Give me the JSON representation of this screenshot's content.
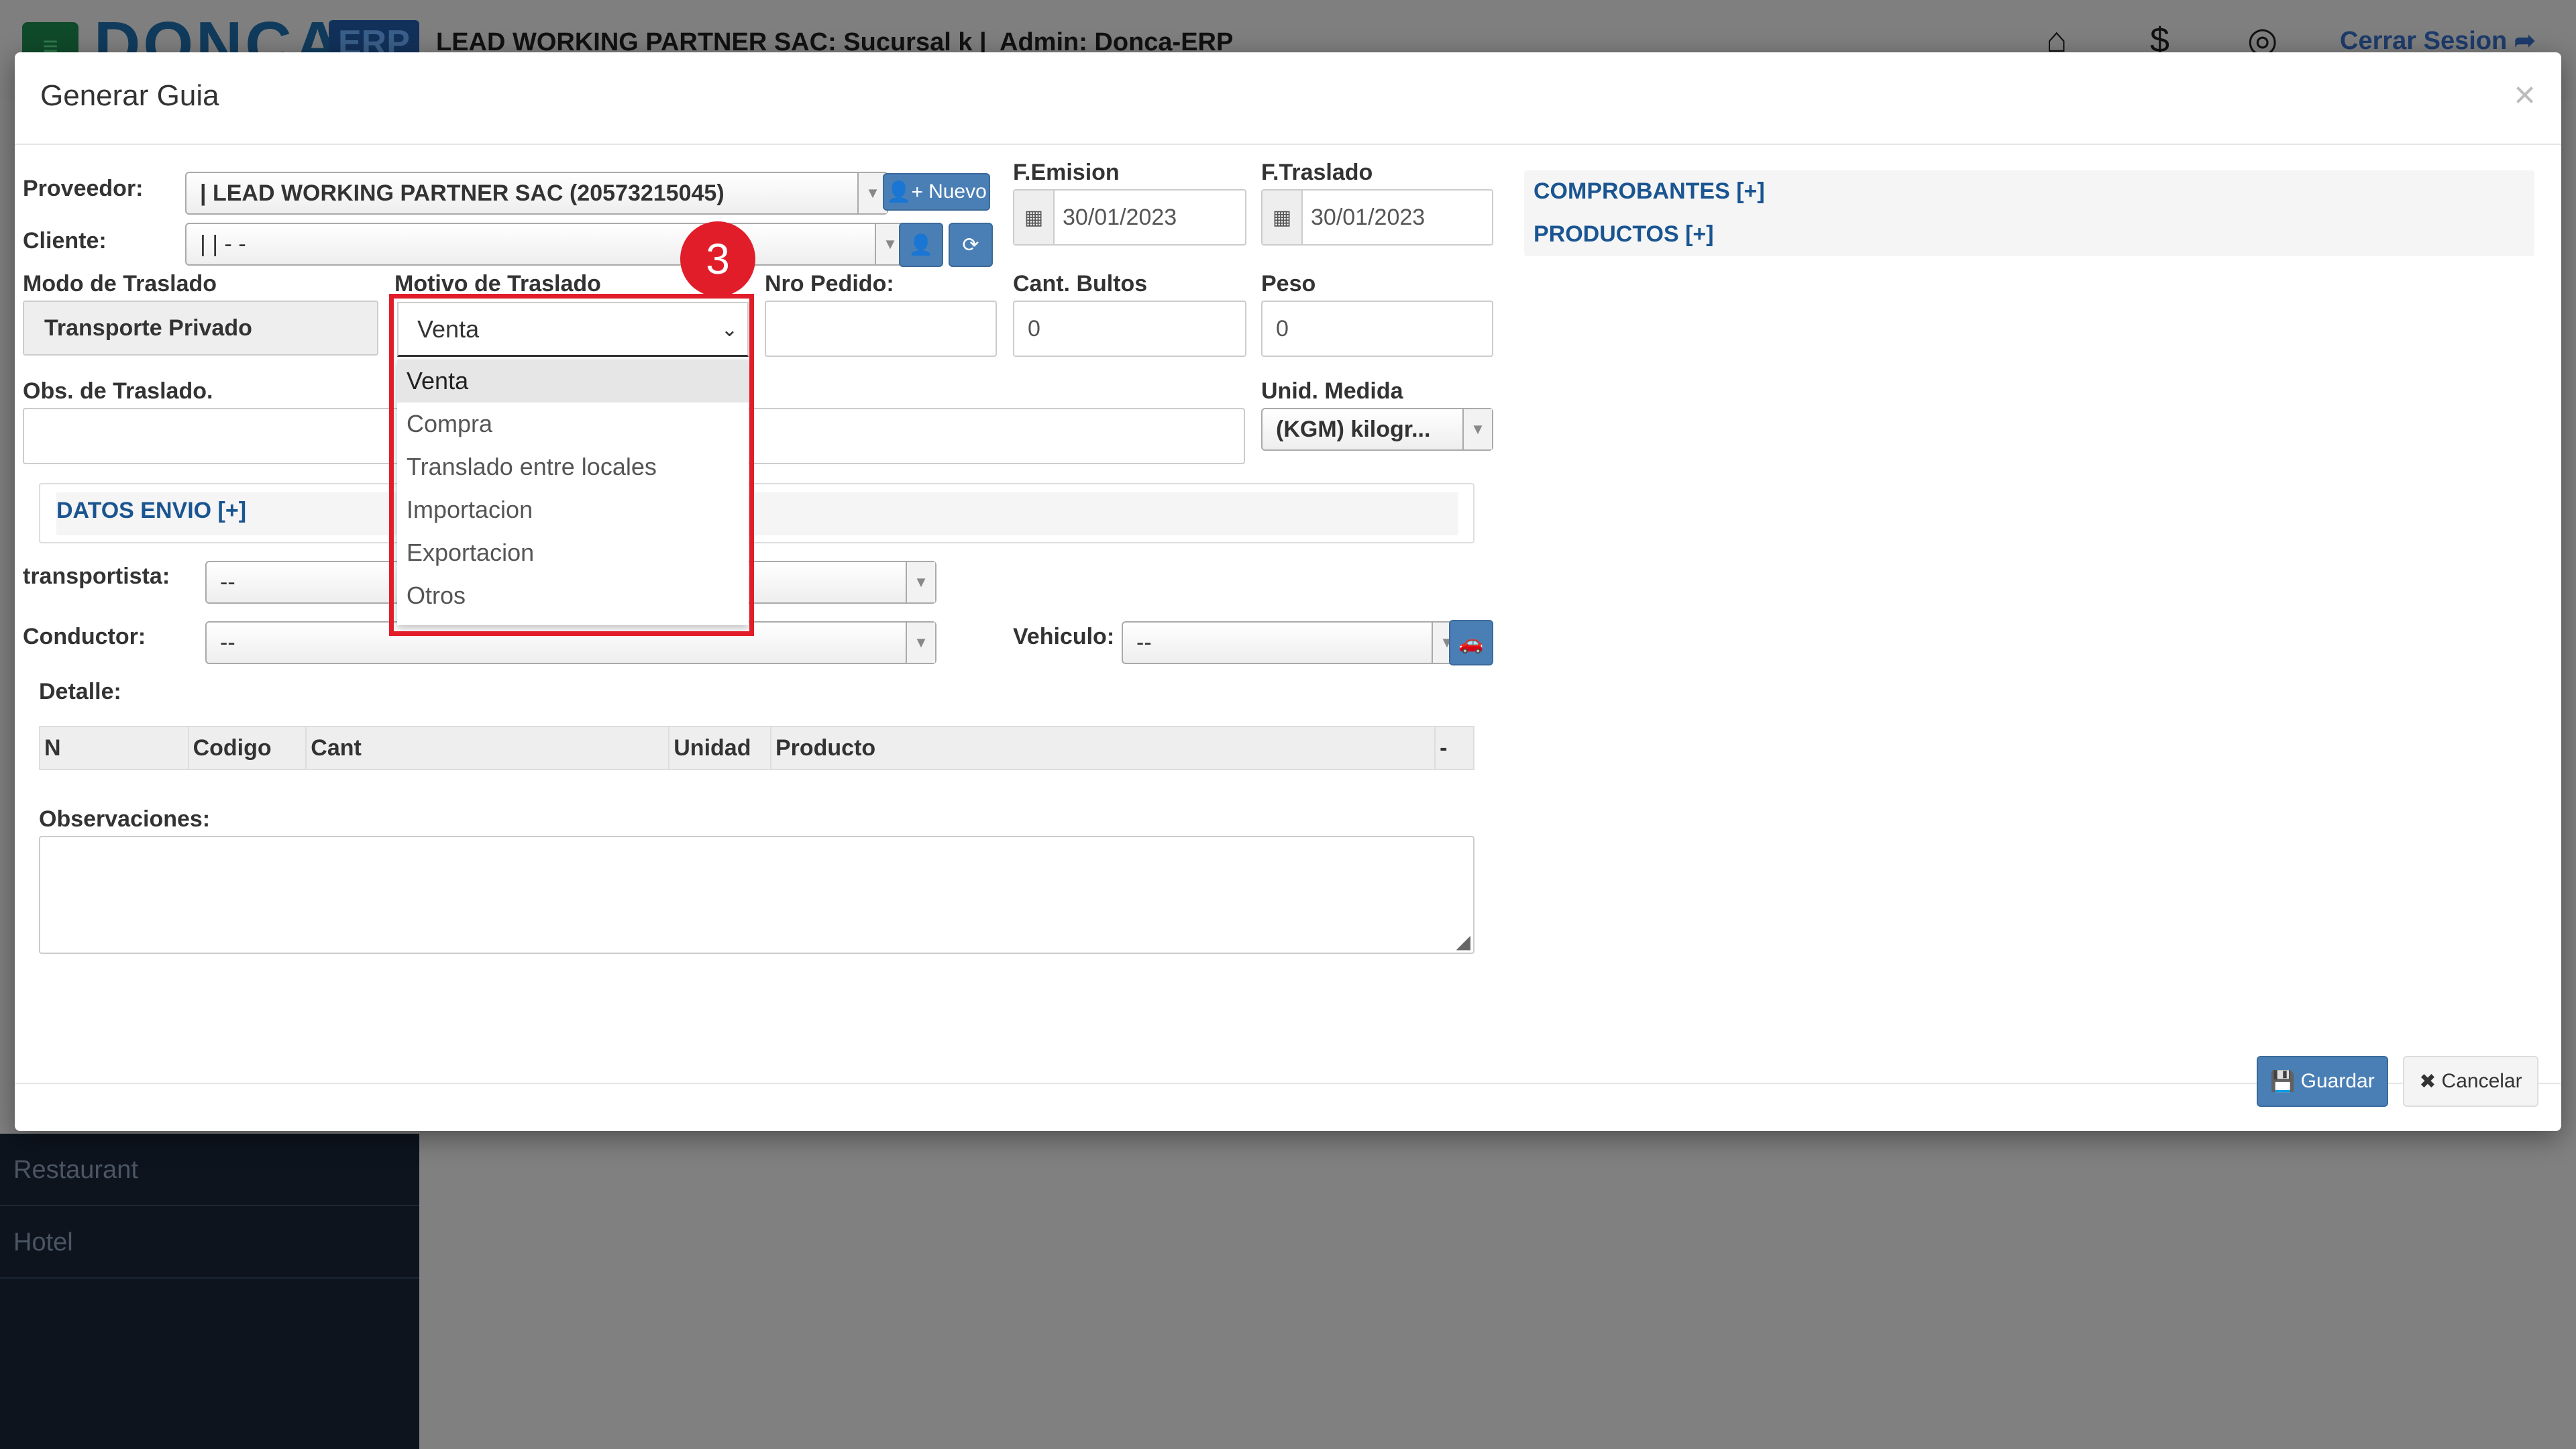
{
  "app": {
    "logo": "DONCA",
    "logo_badge": "ERP",
    "company": "LEAD WORKING PARTNER SAC: Sucursal k |",
    "admin": "Admin: Donca-ERP",
    "logout": "Cerrar Sesion",
    "sidebar": [
      "Restaurant",
      "Hotel"
    ]
  },
  "modal": {
    "title": "Generar Guia",
    "close": "×",
    "proveedor": {
      "label": "Proveedor:",
      "value": "| LEAD WORKING PARTNER SAC (20573215045)",
      "new_button": "Nuevo"
    },
    "cliente": {
      "label": "Cliente:",
      "value": "| | - -"
    },
    "f_emision": {
      "label": "F.Emision",
      "value": "30/01/2023"
    },
    "f_traslado": {
      "label": "F.Traslado",
      "value": "30/01/2023"
    },
    "modo_traslado": {
      "label": "Modo de Traslado",
      "value": "Transporte Privado"
    },
    "motivo_traslado": {
      "label": "Motivo de Traslado",
      "value": "Venta",
      "options": [
        "Venta",
        "Compra",
        "Translado entre locales",
        "Importacion",
        "Exportacion",
        "Otros"
      ]
    },
    "nro_pedido": {
      "label": "Nro Pedido:",
      "value": ""
    },
    "cant_bultos": {
      "label": "Cant. Bultos",
      "value": "0"
    },
    "peso": {
      "label": "Peso",
      "value": "0"
    },
    "obs_traslado": {
      "label": "Obs. de Traslado.",
      "value": ""
    },
    "unid_medida": {
      "label": "Unid. Medida",
      "value": "(KGM) kilogr..."
    },
    "datos_envio": "DATOS ENVIO [+]",
    "transportista": {
      "label": "transportista:",
      "value": "--"
    },
    "conductor": {
      "label": "Conductor:",
      "value": "--"
    },
    "vehiculo": {
      "label": "Vehiculo:",
      "value": "--"
    },
    "detalle": {
      "label": "Detalle:",
      "columns": [
        "N",
        "Codigo",
        "Cant",
        "Unidad",
        "Producto",
        "-"
      ]
    },
    "observaciones": {
      "label": "Observaciones:"
    },
    "comprobantes": "COMPROBANTES [+]",
    "productos": "PRODUCTOS [+]",
    "save_button": "Guardar",
    "cancel_button": "Cancelar"
  },
  "annotation": {
    "step": "3"
  },
  "colors": {
    "primary_button": "#4a7fb5",
    "highlight": "#e11d2a",
    "link": "#1a5591"
  }
}
